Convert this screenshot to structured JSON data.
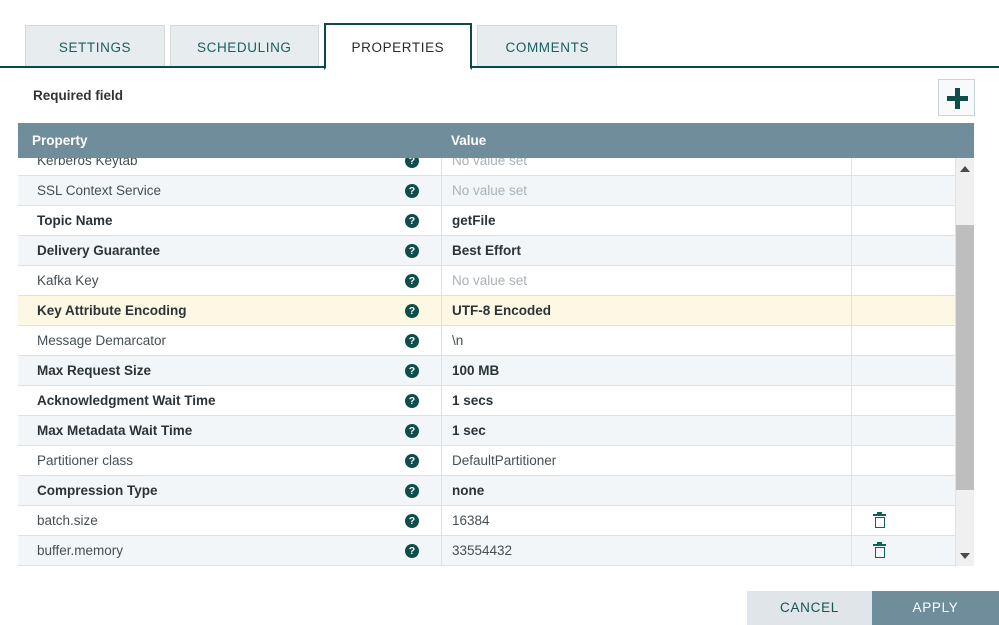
{
  "tabs": [
    {
      "label": "SETTINGS",
      "active": false
    },
    {
      "label": "SCHEDULING",
      "active": false
    },
    {
      "label": "PROPERTIES",
      "active": true
    },
    {
      "label": "COMMENTS",
      "active": false
    }
  ],
  "toolbar": {
    "required_field_label": "Required field",
    "add_property_icon": "plus-icon"
  },
  "table": {
    "columns": [
      "Property",
      "Value",
      ""
    ],
    "help_icon": "help-circle-icon",
    "delete_icon": "trash-icon",
    "rows": [
      {
        "property": "Kerberos Keytab",
        "value": "No value set",
        "required": false,
        "empty": true,
        "highlight": false,
        "deletable": false
      },
      {
        "property": "SSL Context Service",
        "value": "No value set",
        "required": false,
        "empty": true,
        "highlight": false,
        "deletable": false
      },
      {
        "property": "Topic Name",
        "value": "getFile",
        "required": true,
        "empty": false,
        "highlight": false,
        "deletable": false
      },
      {
        "property": "Delivery Guarantee",
        "value": "Best Effort",
        "required": true,
        "empty": false,
        "highlight": false,
        "deletable": false
      },
      {
        "property": "Kafka Key",
        "value": "No value set",
        "required": false,
        "empty": true,
        "highlight": false,
        "deletable": false
      },
      {
        "property": "Key Attribute Encoding",
        "value": "UTF-8 Encoded",
        "required": true,
        "empty": false,
        "highlight": true,
        "deletable": false
      },
      {
        "property": "Message Demarcator",
        "value": "\\n",
        "required": false,
        "empty": false,
        "highlight": false,
        "deletable": false
      },
      {
        "property": "Max Request Size",
        "value": "100 MB",
        "required": true,
        "empty": false,
        "highlight": false,
        "deletable": false
      },
      {
        "property": "Acknowledgment Wait Time",
        "value": "1 secs",
        "required": true,
        "empty": false,
        "highlight": false,
        "deletable": false
      },
      {
        "property": "Max Metadata Wait Time",
        "value": "1 sec",
        "required": true,
        "empty": false,
        "highlight": false,
        "deletable": false
      },
      {
        "property": "Partitioner class",
        "value": "DefaultPartitioner",
        "required": false,
        "empty": false,
        "highlight": false,
        "deletable": false
      },
      {
        "property": "Compression Type",
        "value": "none",
        "required": true,
        "empty": false,
        "highlight": false,
        "deletable": false
      },
      {
        "property": "batch.size",
        "value": "16384",
        "required": false,
        "empty": false,
        "highlight": false,
        "deletable": true
      },
      {
        "property": "buffer.memory",
        "value": "33554432",
        "required": false,
        "empty": false,
        "highlight": false,
        "deletable": true
      }
    ]
  },
  "scrollbar": {
    "up_arrow_icon": "chevron-up-icon",
    "down_arrow_icon": "chevron-down-icon"
  },
  "footer": {
    "cancel_label": "CANCEL",
    "apply_label": "APPLY"
  },
  "colors": {
    "accent": "#0d4d4a",
    "header_bar": "#708d9b",
    "highlight_row": "#fdf8e3",
    "tab_inactive": "#e7ecee"
  }
}
